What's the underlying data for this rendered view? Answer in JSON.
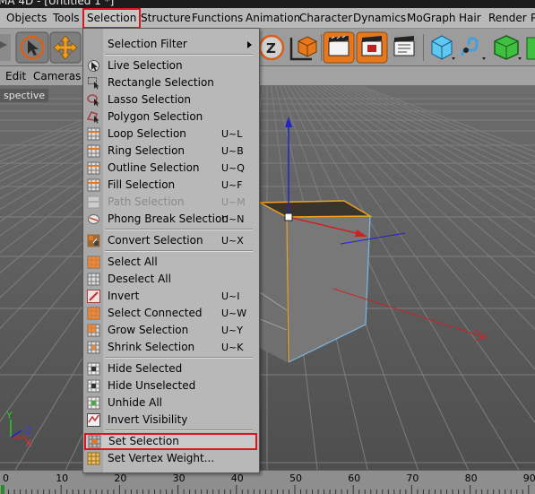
{
  "window": {
    "title": "MA 4D - [Untitled 1 *]"
  },
  "menubar": {
    "items": [
      {
        "label": "Objects",
        "name": "menu-objects"
      },
      {
        "label": "Tools",
        "name": "menu-tools"
      },
      {
        "label": "Selection",
        "name": "menu-selection",
        "active": true
      },
      {
        "label": "Structure",
        "name": "menu-structure"
      },
      {
        "label": "Functions",
        "name": "menu-functions"
      },
      {
        "label": "Animation",
        "name": "menu-animation"
      },
      {
        "label": "Character",
        "name": "menu-character"
      },
      {
        "label": "Dynamics",
        "name": "menu-dynamics"
      },
      {
        "label": "MoGraph",
        "name": "menu-mograph"
      },
      {
        "label": "Hair",
        "name": "menu-hair"
      },
      {
        "label": "Render",
        "name": "menu-render"
      },
      {
        "label": "P",
        "name": "menu-plugins-truncated"
      }
    ]
  },
  "toolbar": {
    "buttons": [
      {
        "icon": "undo-arrows-icon"
      },
      {
        "icon": "select-arrow-icon",
        "active": true
      },
      {
        "icon": "move-icon",
        "active": true
      },
      {
        "icon": "scale-z-icon"
      },
      {
        "icon": "coordinate-object-icon"
      },
      {
        "icon": "render-view-icon"
      },
      {
        "icon": "render-picture-icon"
      },
      {
        "icon": "render-settings-icon"
      },
      {
        "icon": "cube-icon"
      },
      {
        "icon": "spline-pen-icon"
      },
      {
        "icon": "subdivision-cube-icon"
      },
      {
        "icon": "array-icon"
      }
    ]
  },
  "viewport_menu": {
    "items": [
      "Edit",
      "Cameras"
    ]
  },
  "viewport": {
    "label": "spective",
    "axis_labels": [
      "Y",
      "Z",
      "X"
    ],
    "colors": {
      "edge_highlight": "#f0a020",
      "y_axis": "#2222cc",
      "x_axis": "#cc2222"
    }
  },
  "dropdown": {
    "items": [
      {
        "type": "item",
        "label": "Selection Filter",
        "submenu": true,
        "icon": "none"
      },
      {
        "type": "sep"
      },
      {
        "type": "item",
        "label": "Live Selection",
        "icon": "live-selection-icon"
      },
      {
        "type": "item",
        "label": "Rectangle Selection",
        "icon": "rectangle-selection-icon"
      },
      {
        "type": "item",
        "label": "Lasso Selection",
        "icon": "lasso-selection-icon"
      },
      {
        "type": "item",
        "label": "Polygon Selection",
        "icon": "polygon-selection-icon"
      },
      {
        "type": "item",
        "label": "Loop Selection",
        "shortcut": "U~L",
        "icon": "loop-selection-icon"
      },
      {
        "type": "item",
        "label": "Ring Selection",
        "shortcut": "U~B",
        "icon": "ring-selection-icon"
      },
      {
        "type": "item",
        "label": "Outline Selection",
        "shortcut": "U~Q",
        "icon": "outline-selection-icon"
      },
      {
        "type": "item",
        "label": "Fill Selection",
        "shortcut": "U~F",
        "icon": "fill-selection-icon"
      },
      {
        "type": "item",
        "label": "Path Selection",
        "shortcut": "U~M",
        "icon": "path-selection-icon",
        "disabled": true
      },
      {
        "type": "item",
        "label": "Phong Break Selection",
        "shortcut": "U~N",
        "icon": "phong-break-icon"
      },
      {
        "type": "sep"
      },
      {
        "type": "item",
        "label": "Convert Selection",
        "shortcut": "U~X",
        "icon": "convert-selection-icon"
      },
      {
        "type": "sep"
      },
      {
        "type": "item",
        "label": "Select All",
        "icon": "select-all-icon"
      },
      {
        "type": "item",
        "label": "Deselect All",
        "icon": "deselect-all-icon"
      },
      {
        "type": "item",
        "label": "Invert",
        "shortcut": "U~I",
        "icon": "invert-icon"
      },
      {
        "type": "item",
        "label": "Select Connected",
        "shortcut": "U~W",
        "icon": "select-connected-icon"
      },
      {
        "type": "item",
        "label": "Grow Selection",
        "shortcut": "U~Y",
        "icon": "grow-selection-icon"
      },
      {
        "type": "item",
        "label": "Shrink Selection",
        "shortcut": "U~K",
        "icon": "shrink-selection-icon"
      },
      {
        "type": "sep"
      },
      {
        "type": "item",
        "label": "Hide Selected",
        "icon": "hide-selected-icon"
      },
      {
        "type": "item",
        "label": "Hide Unselected",
        "icon": "hide-unselected-icon"
      },
      {
        "type": "item",
        "label": "Unhide All",
        "icon": "unhide-all-icon"
      },
      {
        "type": "item",
        "label": "Invert Visibility",
        "icon": "invert-visibility-icon"
      },
      {
        "type": "sep"
      },
      {
        "type": "item",
        "label": "Set Selection",
        "icon": "set-selection-icon",
        "highlight": true
      },
      {
        "type": "item",
        "label": "Set Vertex Weight...",
        "icon": "vertex-weight-icon"
      }
    ]
  },
  "timeline": {
    "ticks": [
      "0",
      "10",
      "20",
      "30",
      "40",
      "50",
      "60",
      "70",
      "80",
      "90"
    ]
  },
  "colors": {
    "highlight_border": "#e0141e",
    "accent_orange": "#e8781e"
  }
}
